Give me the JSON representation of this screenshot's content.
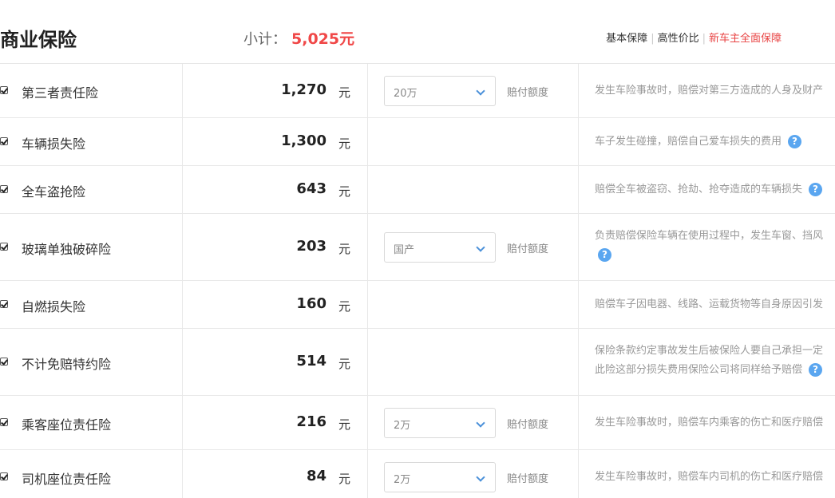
{
  "header": {
    "title": "商业保险",
    "subtotal_label": "小计：",
    "subtotal_value": "5,025元",
    "filters": [
      "基本保障",
      "高性价比",
      "新车主全面保障"
    ],
    "active_filter": "新车主全面保障"
  },
  "columns": {
    "unit": "元",
    "payout_label": "赔付额度"
  },
  "rows": [
    {
      "name": "第三者责任险",
      "price": "1,270",
      "checked": true,
      "option": "20万",
      "desc": [
        "发生车险事故时，赔偿对第三方造成的人身及财产"
      ],
      "help": false
    },
    {
      "name": "车辆损失险",
      "price": "1,300",
      "checked": true,
      "option": null,
      "desc": [
        "车子发生碰撞，赔偿自己爱车损失的费用"
      ],
      "help": true
    },
    {
      "name": "全车盗抢险",
      "price": "643",
      "checked": true,
      "option": null,
      "desc": [
        "赔偿全车被盗窃、抢劫、抢夺造成的车辆损失"
      ],
      "help": true
    },
    {
      "name": "玻璃单独破碎险",
      "price": "203",
      "checked": true,
      "option": "国产",
      "desc": [
        "负责赔偿保险车辆在使用过程中，发生车窗、挡风"
      ],
      "help": true
    },
    {
      "name": "自燃损失险",
      "price": "160",
      "checked": true,
      "option": null,
      "desc": [
        "赔偿车子因电器、线路、运载货物等自身原因引发"
      ],
      "help": false
    },
    {
      "name": "不计免赔特约险",
      "price": "514",
      "checked": true,
      "option": null,
      "desc": [
        "保险条款约定事故发生后被保险人要自己承担一定",
        "此险这部分损失费用保险公司将同样给予赔偿"
      ],
      "help": true
    },
    {
      "name": "乘客座位责任险",
      "price": "216",
      "checked": true,
      "option": "2万",
      "desc": [
        "发生车险事故时，赔偿车内乘客的伤亡和医疗赔偿"
      ],
      "help": false
    },
    {
      "name": "司机座位责任险",
      "price": "84",
      "checked": true,
      "option": "2万",
      "desc": [
        "发生车险事故时，赔偿车内司机的伤亡和医疗赔偿"
      ],
      "help": false
    }
  ],
  "icons": {
    "help": "question-mark-icon",
    "dropdown": "chevron-down-icon",
    "checkbox": "checkbox-checked-icon"
  },
  "colors": {
    "accent": "#f04848",
    "link_blue": "#4a90d9",
    "help_bg": "#5aa6f0"
  }
}
